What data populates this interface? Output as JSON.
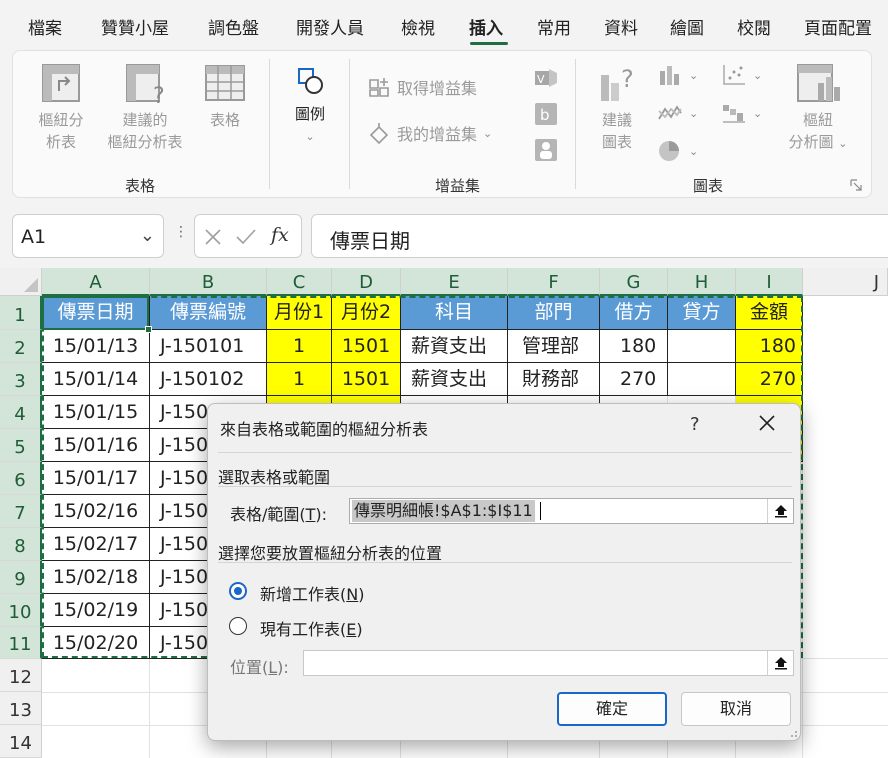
{
  "menu": {
    "tabs": [
      "檔案",
      "贊贊小屋",
      "調色盤",
      "開發人員",
      "檢視",
      "插入",
      "常用",
      "資料",
      "繪圖",
      "校閱",
      "頁面配置"
    ],
    "active": "插入"
  },
  "ribbon": {
    "table_group": {
      "label": "表格",
      "pivot_line1": "樞紐分",
      "pivot_line2": "析表",
      "recommended_line1": "建議的",
      "recommended_line2": "樞紐分析表",
      "table": "表格"
    },
    "illustrations": {
      "line1": "圖例"
    },
    "addins_group": {
      "label": "增益集",
      "get_addins": "取得增益集",
      "my_addins": "我的增益集"
    },
    "charts_group": {
      "label": "圖表",
      "recommended_line1": "建議",
      "recommended_line2": "圖表",
      "pivotchart_line1": "樞紐",
      "pivotchart_line2": "分析圖"
    }
  },
  "formula_bar": {
    "name_box": "A1",
    "fx_symbol": "fx",
    "value": "傳票日期"
  },
  "sheet": {
    "columns": [
      "A",
      "B",
      "C",
      "D",
      "E",
      "F",
      "G",
      "H",
      "I",
      "J"
    ],
    "rows": [
      "1",
      "2",
      "3",
      "4",
      "5",
      "6",
      "7",
      "8",
      "9",
      "10",
      "11",
      "12",
      "13",
      "14"
    ],
    "header": [
      "傳票日期",
      "傳票編號",
      "月份1",
      "月份2",
      "科目",
      "部門",
      "借方",
      "貸方",
      "金額"
    ],
    "col_a": [
      "15/01/13",
      "15/01/14",
      "15/01/15",
      "15/01/16",
      "15/01/17",
      "15/02/16",
      "15/02/17",
      "15/02/18",
      "15/02/19",
      "15/02/20"
    ],
    "col_b": [
      "J-150101",
      "J-150102",
      "J-150",
      "J-150",
      "J-150",
      "J-150",
      "J-150",
      "J-150",
      "J-150",
      "J-150"
    ],
    "row2": {
      "c": "1",
      "d": "1501",
      "e": "薪資支出",
      "f": "管理部",
      "g": "180",
      "i": "180"
    },
    "row3": {
      "c": "1",
      "d": "1501",
      "e": "薪資支出",
      "f": "財務部",
      "g": "270",
      "i": "270"
    }
  },
  "dialog": {
    "title": "來自表格或範圍的樞紐分析表",
    "help": "?",
    "section1": "選取表格或範圍",
    "range_label_pre": "表格/範圍(",
    "range_label_key": "T",
    "range_label_post": "):",
    "range_value": "傳票明細帳!$A$1:$I$11",
    "section2": "選擇您要放置樞紐分析表的位置",
    "option_new_pre": "新增工作表(",
    "option_new_key": "N",
    "option_new_post": ")",
    "option_existing_pre": "現有工作表(",
    "option_existing_key": "E",
    "option_existing_post": ")",
    "location_pre": "位置(",
    "location_key": "L",
    "location_post": "):",
    "location_value": "",
    "ok": "確定",
    "cancel": "取消"
  }
}
